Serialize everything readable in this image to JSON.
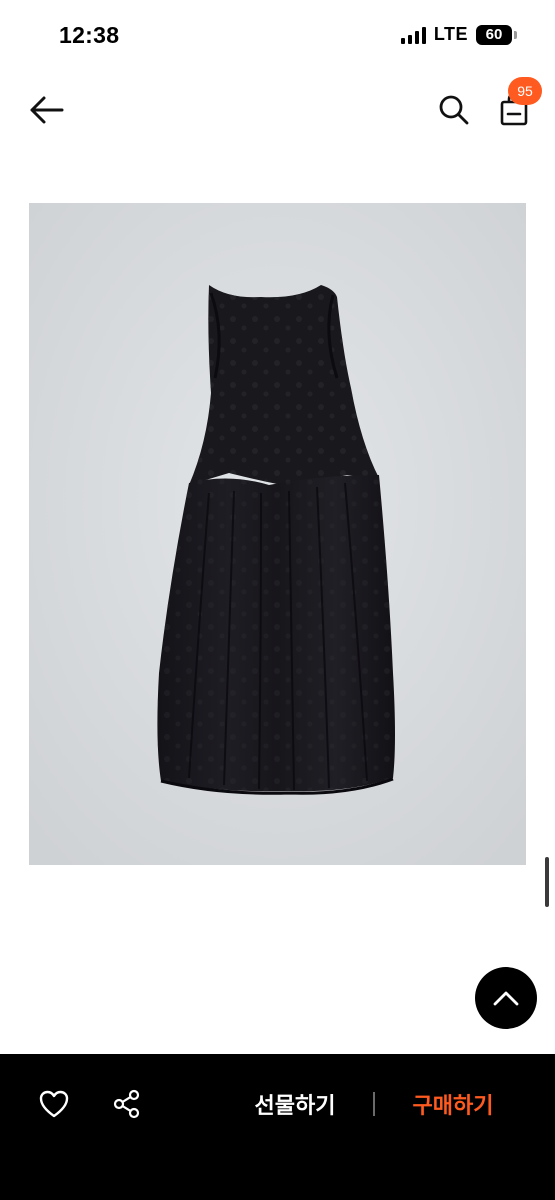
{
  "status_bar": {
    "time": "12:38",
    "network": "LTE",
    "battery": "60"
  },
  "nav": {
    "back_icon": "arrow-left-icon",
    "search_icon": "search-icon",
    "bag_icon": "shopping-bag-icon",
    "cart_badge": "95"
  },
  "product": {
    "image_subject": "black sleeveless midi dress",
    "image_background": "#d9dcdf"
  },
  "scroll_top_icon": "chevron-up-icon",
  "bottom_bar": {
    "like_icon": "heart-icon",
    "share_icon": "share-icon",
    "gift_label": "선물하기",
    "buy_label": "구매하기"
  },
  "colors": {
    "accent": "#ff5a1f",
    "bar_background": "#000000"
  }
}
